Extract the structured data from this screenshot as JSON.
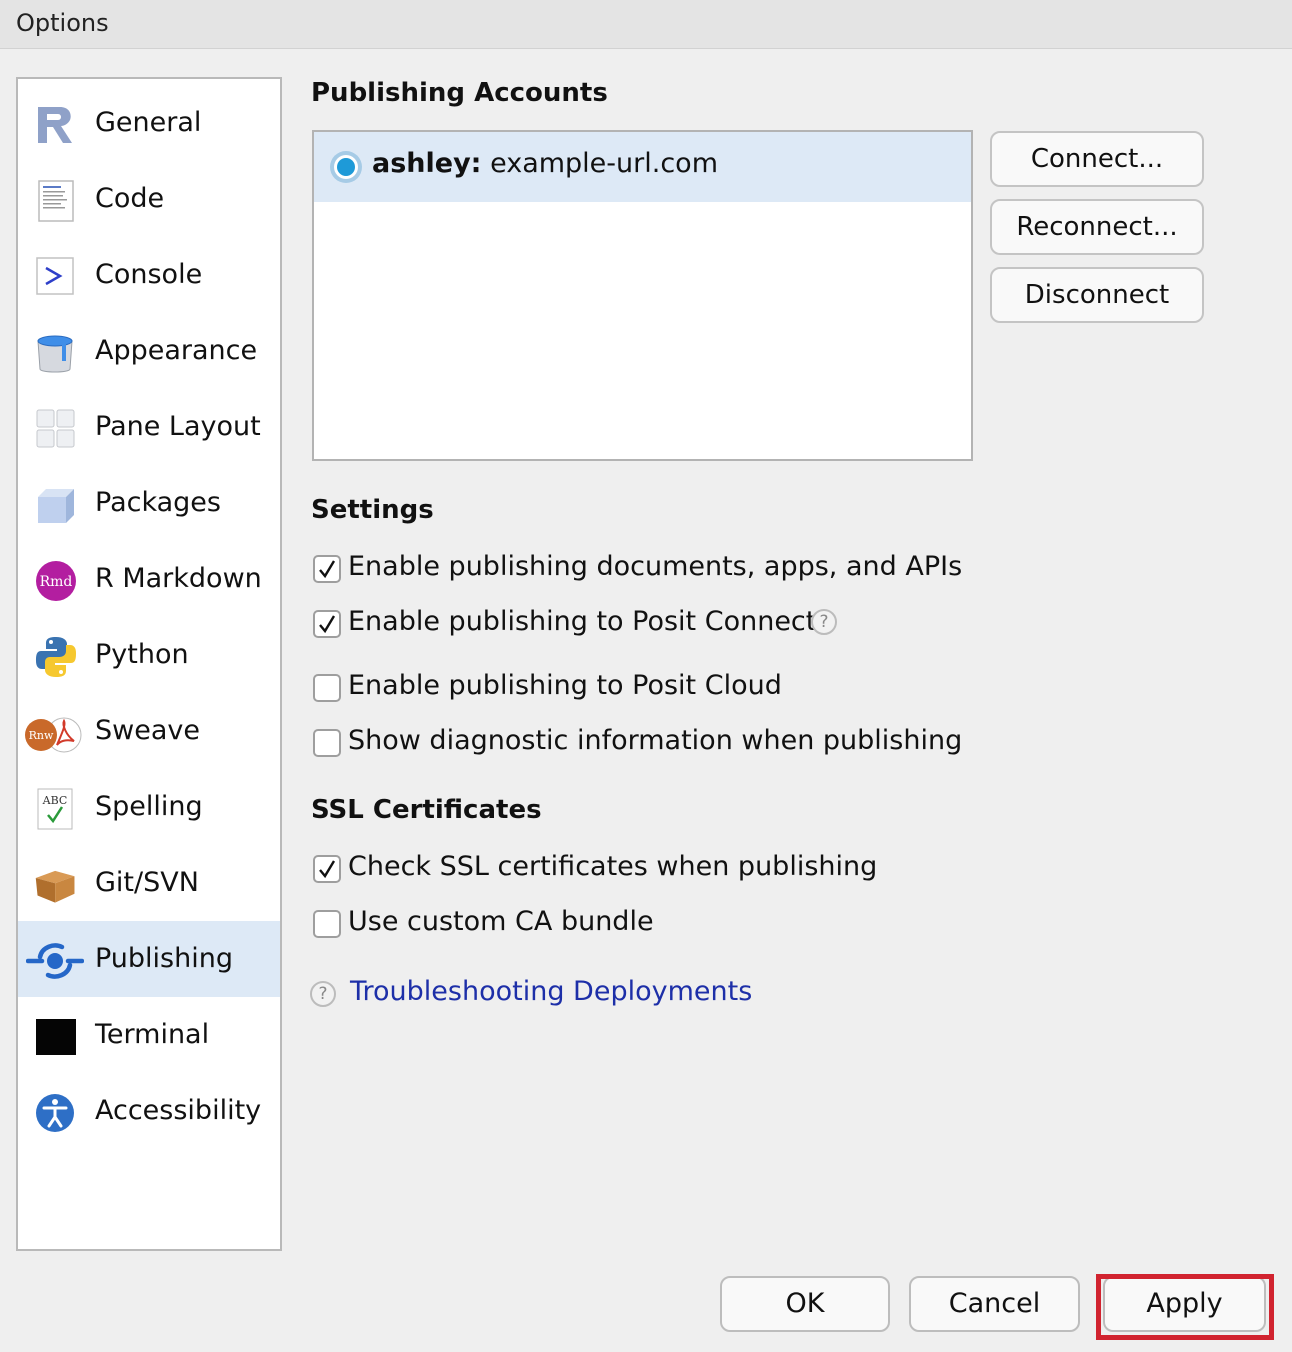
{
  "window": {
    "title": "Options"
  },
  "sidebar": {
    "items": [
      {
        "label": "General",
        "icon": "r-logo-icon"
      },
      {
        "label": "Code",
        "icon": "code-icon"
      },
      {
        "label": "Console",
        "icon": "console-icon"
      },
      {
        "label": "Appearance",
        "icon": "paint-bucket-icon"
      },
      {
        "label": "Pane Layout",
        "icon": "pane-layout-icon"
      },
      {
        "label": "Packages",
        "icon": "package-box-icon"
      },
      {
        "label": "R Markdown",
        "icon": "rmd-icon"
      },
      {
        "label": "Python",
        "icon": "python-icon"
      },
      {
        "label": "Sweave",
        "icon": "sweave-icon"
      },
      {
        "label": "Spelling",
        "icon": "spelling-icon"
      },
      {
        "label": "Git/SVN",
        "icon": "git-box-icon"
      },
      {
        "label": "Publishing",
        "icon": "publishing-icon"
      },
      {
        "label": "Terminal",
        "icon": "terminal-icon"
      },
      {
        "label": "Accessibility",
        "icon": "accessibility-icon"
      }
    ],
    "selected": "Publishing",
    "selected_bg": "#dde9f6"
  },
  "accounts": {
    "title": "Publishing Accounts",
    "items": [
      {
        "user": "ashley:",
        "server": "example-url.com"
      }
    ],
    "buttons": {
      "connect": "Connect...",
      "reconnect": "Reconnect...",
      "disconnect": "Disconnect"
    }
  },
  "settings": {
    "title": "Settings",
    "options": [
      {
        "label": "Enable publishing documents, apps, and APIs",
        "checked": true
      },
      {
        "label": "Enable publishing to Posit Connect",
        "checked": true,
        "help_text": "?"
      },
      {
        "label": "Enable publishing to Posit Cloud",
        "checked": false
      },
      {
        "label": "Show diagnostic information when publishing",
        "checked": false
      }
    ]
  },
  "ssl": {
    "title": "SSL Certificates",
    "options": [
      {
        "label": "Check SSL certificates when publishing",
        "checked": true
      },
      {
        "label": "Use custom CA bundle",
        "checked": false
      }
    ]
  },
  "help": {
    "icon_text": "?",
    "link": "Troubleshooting Deployments",
    "link_color": "#1d2fa8"
  },
  "footer": {
    "ok": "OK",
    "cancel": "Cancel",
    "apply": "Apply",
    "highlight_color": "#d1232f"
  }
}
